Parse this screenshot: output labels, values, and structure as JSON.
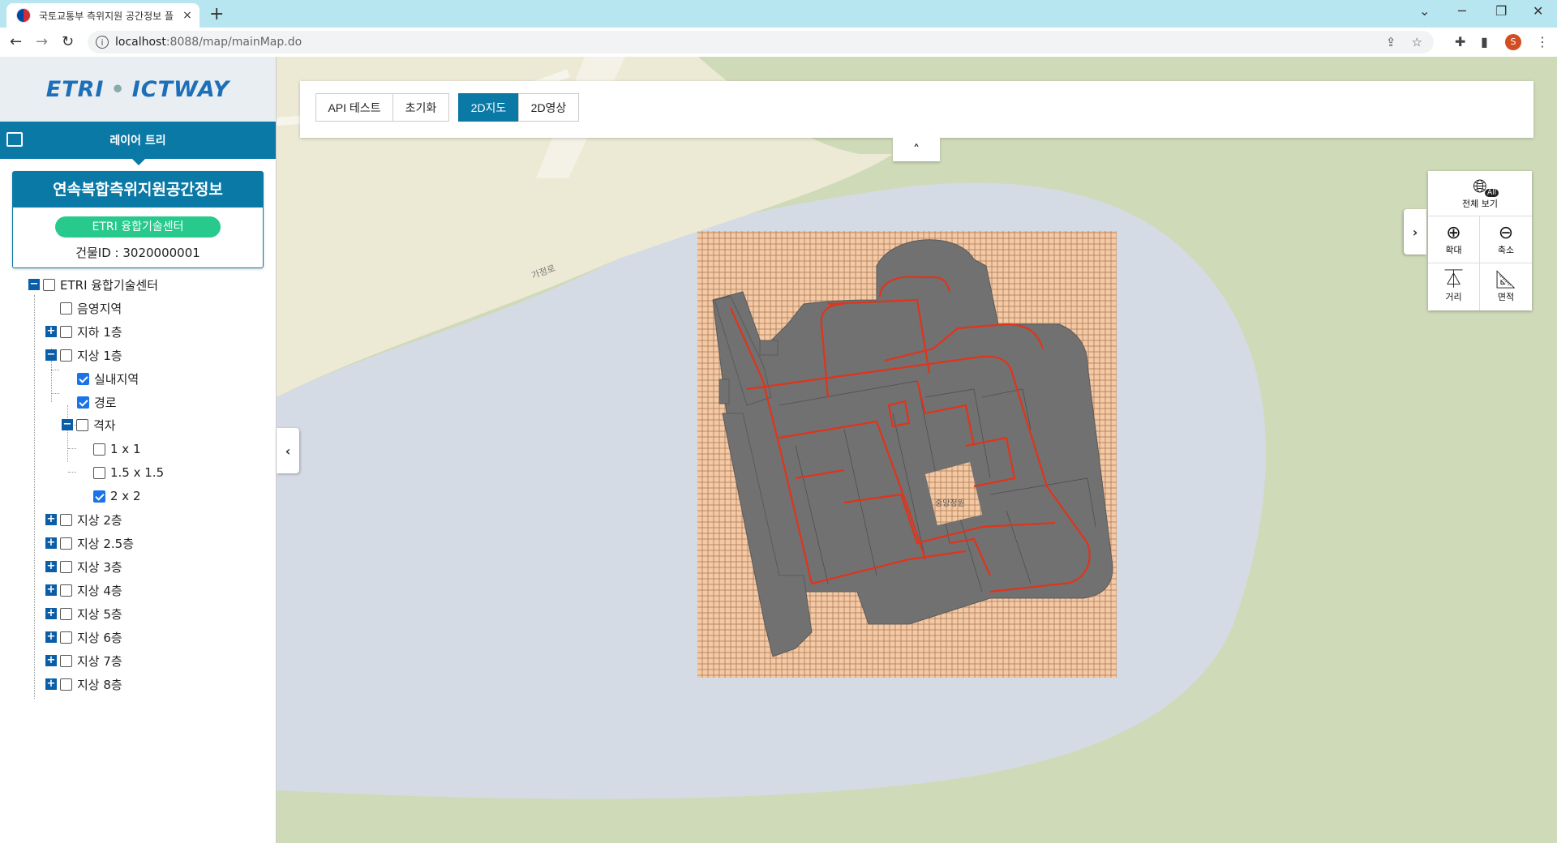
{
  "browser": {
    "tab_title": "국토교통부 측위지원 공간정보 플",
    "tab_close": "×",
    "new_tab": "+",
    "url_host": "localhost",
    "url_rest": ":8088/map/mainMap.do",
    "profile_initial": "S",
    "controls": {
      "minimize": "─",
      "maximize": "❐",
      "close": "✕",
      "dropdown": "⌄"
    }
  },
  "sidebar": {
    "logo_left": "ETRI",
    "logo_dot": "•",
    "logo_right": "ICTWAY",
    "layer_tree_title": "레이어 트리",
    "card_title": "연속복합측위지원공간정보",
    "card_pill": "ETRI 융합기술센터",
    "card_building_id": "건물ID : 3020000001"
  },
  "tree": {
    "root": "ETRI 융합기술센터",
    "shadow": "음영지역",
    "b1": "지하 1층",
    "f1": "지상 1층",
    "indoor": "실내지역",
    "route": "경로",
    "grid": "격자",
    "g1": "1 x 1",
    "g15": "1.5 x 1.5",
    "g2": "2 x 2",
    "f2": "지상 2층",
    "f25": "지상 2.5층",
    "f3": "지상 3층",
    "f4": "지상 4층",
    "f5": "지상 5층",
    "f6": "지상 6층",
    "f7": "지상 7층",
    "f8": "지상 8층",
    "plus": "+",
    "minus": "−"
  },
  "toolbar": {
    "api_test": "API 테스트",
    "reset": "초기화",
    "map2d": "2D지도",
    "image2d": "2D영상"
  },
  "map_tools": {
    "full_view": "전체 보기",
    "all_badge": "All",
    "zoom_in": "확대",
    "zoom_out": "축소",
    "distance": "거리",
    "area": "면적"
  },
  "map_labels": {
    "road": "가정로",
    "courtyard": "중앙정원"
  },
  "colors": {
    "accent": "#0a79a6",
    "pill": "#27c98c",
    "grid_fill": "#f6c79e",
    "building": "#707070",
    "route": "#e0341c",
    "land": "#cfdab9",
    "water": "#d5dbe4"
  }
}
